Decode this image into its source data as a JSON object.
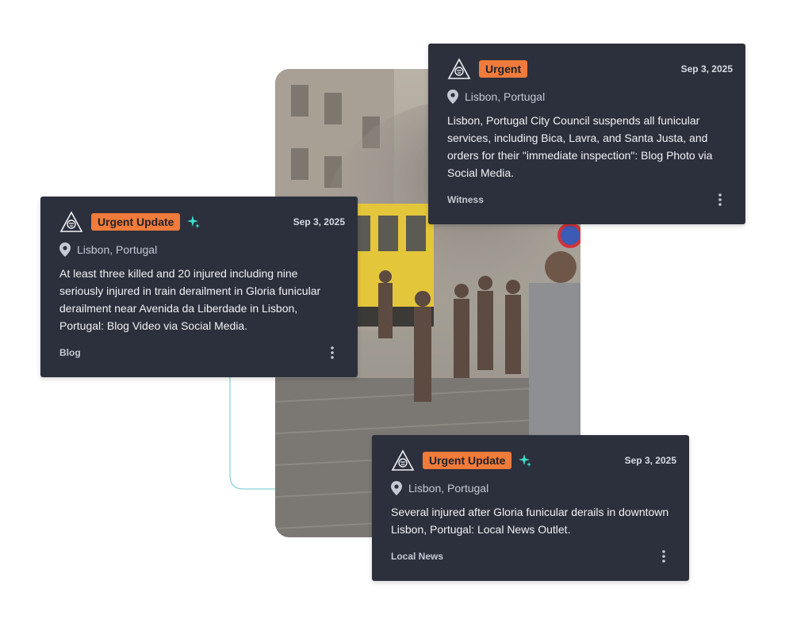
{
  "colors": {
    "card_bg": "#2c303c",
    "badge": "#f07b3a",
    "sparkle": "#3ee0d0",
    "connector": "#6fc6cf"
  },
  "photo": {
    "icon": "street-photo"
  },
  "cards": [
    {
      "badge": "Urgent",
      "has_sparkle": false,
      "date": "Sep 3, 2025",
      "location": "Lisbon, Portugal",
      "text": "Lisbon, Portugal City Council suspends all funicular services, including Bica, Lavra, and Santa Justa, and orders for their \"immediate inspection\": Blog Photo via Social Media.",
      "source": "Witness"
    },
    {
      "badge": "Urgent Update",
      "has_sparkle": true,
      "date": "Sep 3, 2025",
      "location": "Lisbon, Portugal",
      "text": "At least three killed and 20 injured including nine seriously injured in train derailment in Gloria funicular derailment near Avenida da Liberdade in Lisbon, Portugal: Blog Video via Social Media.",
      "source": "Blog"
    },
    {
      "badge": "Urgent Update",
      "has_sparkle": true,
      "date": "Sep 3, 2025",
      "location": "Lisbon, Portugal",
      "text": "Several injured after Gloria funicular derails in downtown Lisbon, Portugal: Local News Outlet.",
      "source": "Local News"
    }
  ]
}
